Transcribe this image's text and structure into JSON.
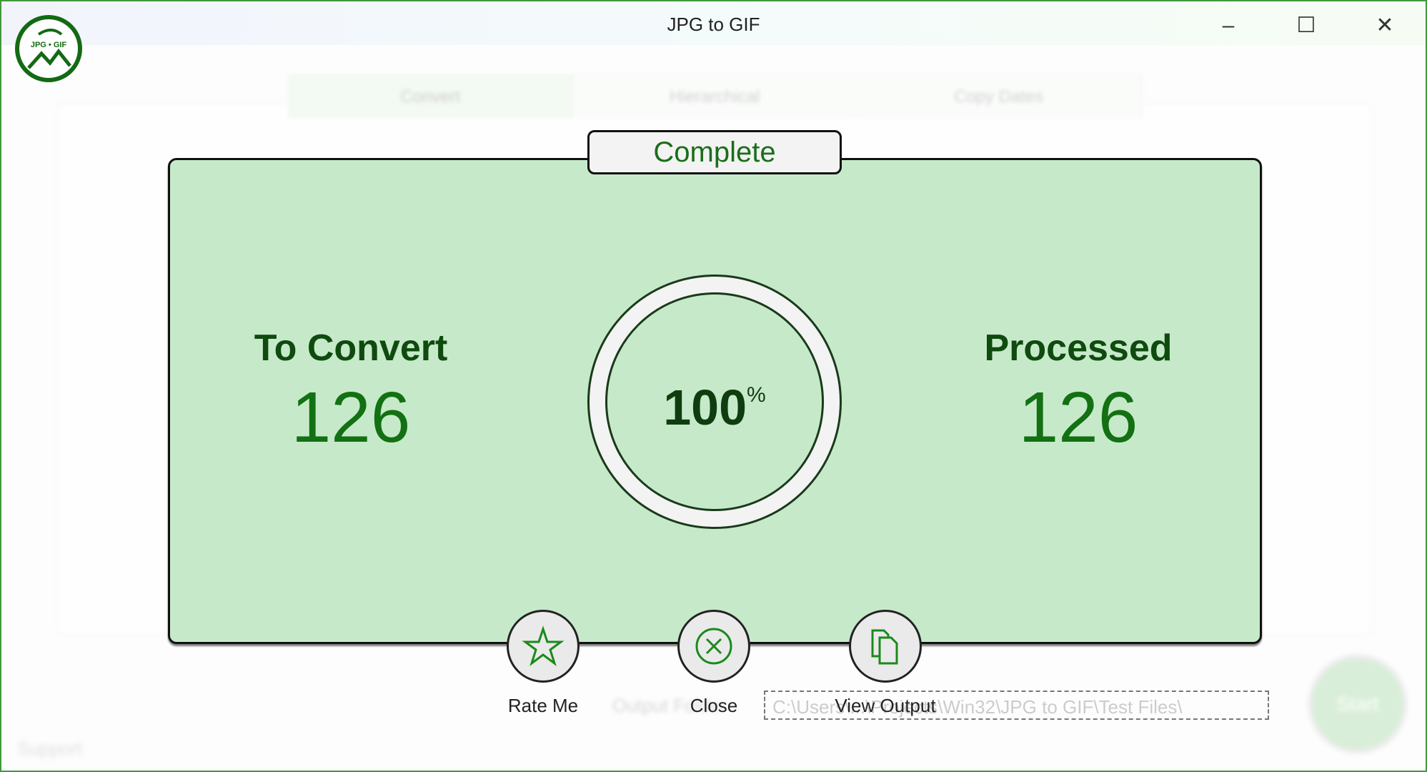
{
  "window": {
    "title": "JPG to GIF",
    "logo_text": "JPG • GIF",
    "controls": {
      "minimize": "–",
      "maximize": "☐",
      "close": "✕"
    }
  },
  "background": {
    "tabs": [
      "Convert",
      "Hierarchical",
      "Copy Dates"
    ],
    "output_label": "Output Folder",
    "output_path": "C:\\Users\\...\\Projects\\Win32\\JPG to GIF\\Test Files\\",
    "start": "Start",
    "support": "Support"
  },
  "dialog": {
    "status": "Complete",
    "to_convert_label": "To Convert",
    "to_convert": "126",
    "processed_label": "Processed",
    "processed": "126",
    "percent": "100",
    "percent_sign": "%",
    "progress_fraction": 1.0
  },
  "actions": [
    {
      "label": "Rate Me",
      "icon": "star-icon"
    },
    {
      "label": "Close",
      "icon": "close-circle-icon"
    },
    {
      "label": "View Output",
      "icon": "copy-files-icon"
    }
  ],
  "colors": {
    "accent": "#137013",
    "panel": "#c6eac9",
    "frame": "#3f9a3f"
  }
}
